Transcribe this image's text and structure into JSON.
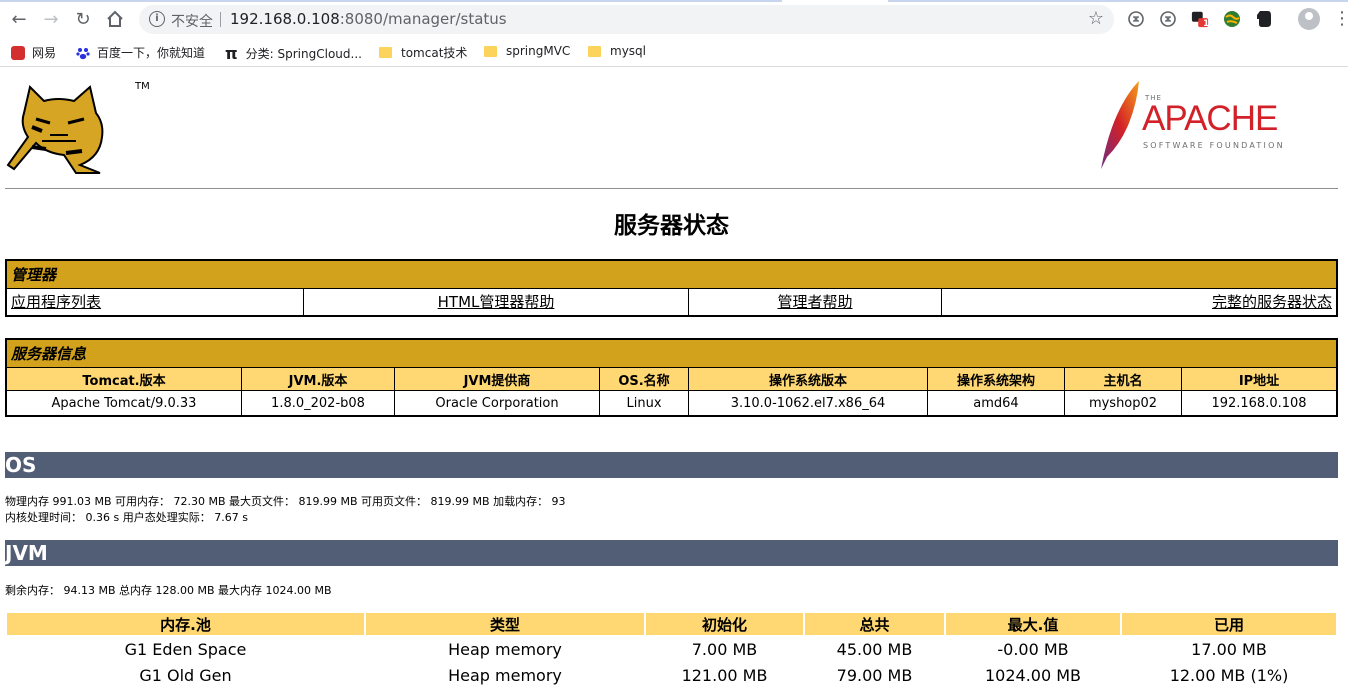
{
  "browser": {
    "insecure_label": "不安全",
    "url_host": "192.168.0.108",
    "url_rest": ":8080/manager/status",
    "badge_count": "1",
    "bookmarks": [
      {
        "label": "网易",
        "icon": "netease-icon"
      },
      {
        "label": "百度一下，你就知道",
        "icon": "baidu-paw-icon"
      },
      {
        "label": "分类: SpringCloud...",
        "icon": "pi-icon"
      },
      {
        "label": "tomcat技术",
        "icon": "folder-icon"
      },
      {
        "label": "springMVC",
        "icon": "folder-icon"
      },
      {
        "label": "mysql",
        "icon": "folder-icon"
      }
    ]
  },
  "page": {
    "title": "服务器状态",
    "tomcat_tm": "TM",
    "apache_logo": {
      "the": "THE",
      "name": "APACHE",
      "foundation": "SOFTWARE FOUNDATION"
    },
    "manager": {
      "heading": "管理器",
      "links": [
        "应用程序列表",
        "HTML管理器帮助",
        "管理者帮助",
        "完整的服务器状态"
      ]
    },
    "server_info": {
      "heading": "服务器信息",
      "headers": [
        "Tomcat.版本",
        "JVM.版本",
        "JVM提供商",
        "OS.名称",
        "操作系统版本",
        "操作系统架构",
        "主机名",
        "IP地址"
      ],
      "values": [
        "Apache Tomcat/9.0.33",
        "1.8.0_202-b08",
        "Oracle Corporation",
        "Linux",
        "3.10.0-1062.el7.x86_64",
        "amd64",
        "myshop02",
        "192.168.0.108"
      ]
    },
    "os": {
      "heading": "OS",
      "line1": "物理内存 991.03 MB 可用内存： 72.30 MB 最大页文件： 819.99 MB 可用页文件： 819.99 MB 加载内存： 93",
      "line2": "内核处理时间： 0.36 s 用户态处理实际： 7.67 s"
    },
    "jvm": {
      "heading": "JVM",
      "line1": "剩余内存： 94.13 MB 总内存 128.00 MB 最大内存 1024.00 MB",
      "pool_headers": [
        "内存.池",
        "类型",
        "初始化",
        "总共",
        "最大.值",
        "已用"
      ],
      "pools": [
        [
          "G1 Eden Space",
          "Heap memory",
          "7.00 MB",
          "45.00 MB",
          "-0.00 MB",
          "17.00 MB"
        ],
        [
          "G1 Old Gen",
          "Heap memory",
          "121.00 MB",
          "79.00 MB",
          "1024.00 MB",
          "12.00 MB (1%)"
        ]
      ]
    }
  }
}
